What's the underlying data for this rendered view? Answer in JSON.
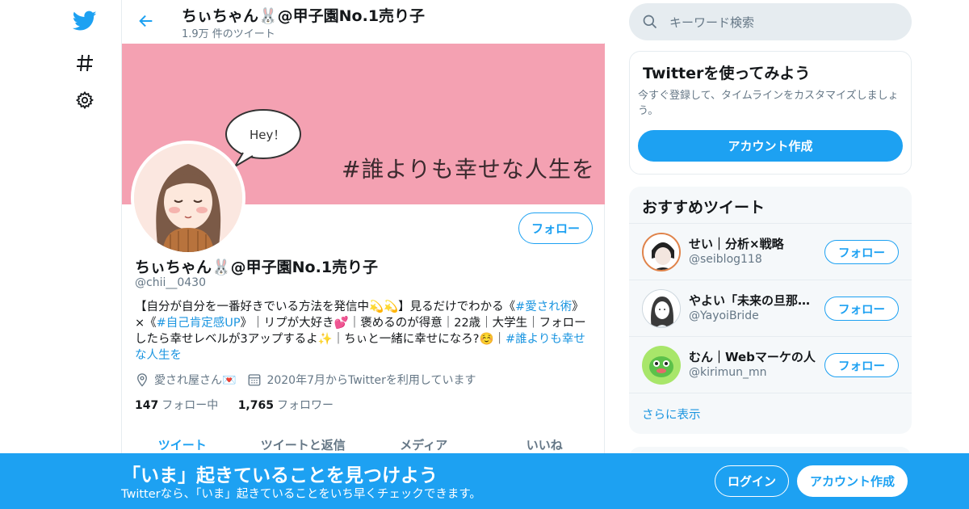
{
  "header": {
    "title": "ちぃちゃん🐰@甲子園No.1売り子",
    "tweet_count": "1.9万 件のツイート"
  },
  "banner": {
    "bubble_text": "Hey！",
    "text": "#誰よりも幸せな人生を"
  },
  "profile": {
    "follow_label": "フォロー",
    "display_name": "ちぃちゃん🐰@甲子園No.1売り子",
    "handle": "@chii__0430",
    "bio": [
      {
        "text": "【自分が自分を一番好きでいる方法を発信中💫💫】見るだけでわかる《",
        "tag": false
      },
      {
        "text": "#愛され術",
        "tag": true
      },
      {
        "text": "》×《",
        "tag": false
      },
      {
        "text": "#自己肯定感UP",
        "tag": true
      },
      {
        "text": "》｜リプが大好き💕｜褒めるのが得意｜22歳｜大学生｜フォローしたら幸せレベルが3アップするよ✨｜ちぃと一緒に幸せになろ?☺️｜",
        "tag": false
      },
      {
        "text": "#誰よりも幸せな人生を",
        "tag": true
      }
    ],
    "location": "愛され屋さん💌",
    "joined": "2020年7月からTwitterを利用しています",
    "following_count": "147",
    "following_label": "フォロー中",
    "followers_count": "1,765",
    "followers_label": "フォロワー"
  },
  "tabs": [
    "ツイート",
    "ツイートと返信",
    "メディア",
    "いいね"
  ],
  "search": {
    "placeholder": "キーワード検索"
  },
  "signup_card": {
    "title": "Twitterを使ってみよう",
    "description": "今すぐ登録して、タイムラインをカスタマイズしましょう。",
    "button": "アカウント作成"
  },
  "recommend": {
    "title": "おすすめツイート",
    "users": [
      {
        "name": "せい｜分析×戦略",
        "handle": "@seiblog118",
        "button": "フォロー"
      },
      {
        "name": "やよい「未来の旦那様を見つける",
        "handle": "@YayoiBride",
        "button": "フォロー"
      },
      {
        "name": "むん｜Webマーケの人",
        "handle": "@kirimun_mn",
        "button": "フォロー"
      }
    ],
    "show_more": "さらに表示"
  },
  "bottom_bar": {
    "title": "「いま」起きていることを見つけよう",
    "subtitle": "Twitterなら、「いま」起きていることをいち早くチェックできます。",
    "login": "ログイン",
    "signup": "アカウント作成"
  },
  "colors": {
    "accent": "#1da1f2",
    "banner": "#f4a1b2"
  }
}
